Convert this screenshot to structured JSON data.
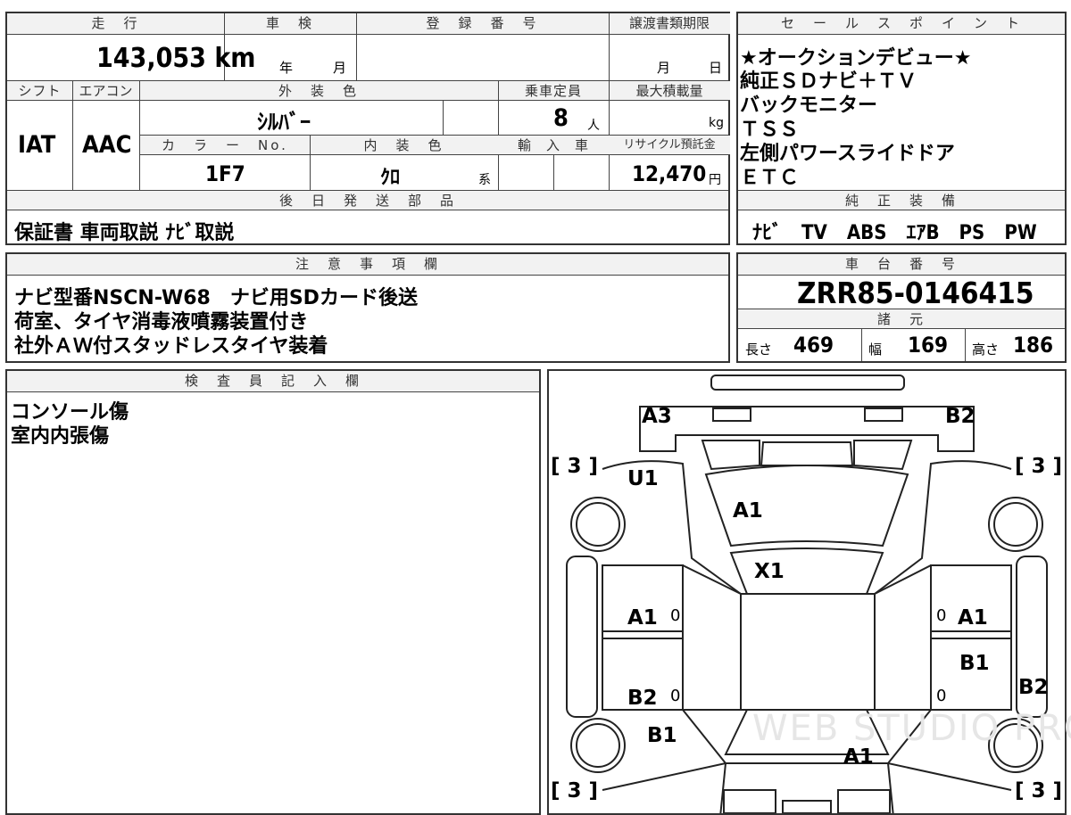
{
  "vehicle": {
    "headers": {
      "mileage": "走　行",
      "inspection": "車　検",
      "registration": "登　録　番　号",
      "transfer_deadline": "譲渡書類期限",
      "shift": "シフト",
      "ac": "エアコン",
      "exterior_color": "外　装　色",
      "capacity": "乗車定員",
      "max_load": "最大積載量",
      "color_no": "カ　ラ　ー　No.",
      "interior_color": "内　装　色",
      "import": "輸　入　車",
      "recycle": "リサイクル預託金",
      "later_parts": "後　日　発　送　部　品"
    },
    "mileage": "143,053 km",
    "inspection_year_unit": "年",
    "inspection_month_unit": "月",
    "transfer_month_unit": "月",
    "transfer_day_unit": "日",
    "shift": "IAT",
    "ac": "AAC",
    "exterior_color": "ｼﾙﾊﾞｰ",
    "capacity": "8",
    "capacity_unit": "人",
    "max_load_unit": "kg",
    "color_no": "1F7",
    "interior_color": "ｸﾛ",
    "interior_color_suffix": "系",
    "recycle_fee": "12,470",
    "recycle_unit": "円",
    "later_parts": "保証書 車両取説 ﾅﾋﾞ取説"
  },
  "sales_points": {
    "header": "セ　ー　ル　ス　ポ　イ　ン　ト",
    "lines": [
      "★オークションデビュー★",
      "純正ＳＤナビ＋ＴＶ",
      "バックモニター",
      "ＴＳＳ",
      "左側パワースライドドア",
      "ＥＴＣ"
    ]
  },
  "equipment": {
    "header": "純　正　装　備",
    "text": "ﾅﾋﾞ　TV　ABS　ｴｱB　PS　PW"
  },
  "notes": {
    "header": "注　意　事　項　欄",
    "lines": [
      "ナビ型番NSCN-W68　ナビ用SDカード後送",
      "荷室、タイヤ消毒液噴霧装置付き",
      "社外ＡＷ付スタッドレスタイヤ装着"
    ]
  },
  "chassis": {
    "header": "車　台　番　号",
    "number": "ZRR85-0146415",
    "spec_header": "諸　元",
    "length_label": "長さ",
    "length": "469",
    "width_label": "幅",
    "width": "169",
    "height_label": "高さ",
    "height": "186"
  },
  "inspector": {
    "header": "検　査　員　記　入　欄",
    "lines": [
      "コンソール傷",
      "室内内張傷"
    ]
  },
  "diagram": {
    "marks": {
      "front_left": "A3",
      "front_right": "B2",
      "hood_left": "U1",
      "hood": "A1",
      "windshield": "X1",
      "door_fl": "A1",
      "door_fr": "A1",
      "door_rr": "B1",
      "door_rl": "B2",
      "sill_l": "B1",
      "fender_rr": "B2",
      "roof_rear": "A1"
    },
    "tire_label": "[ 3 ]",
    "zero": "0",
    "watermark": "WEB STUDIO PRO"
  }
}
